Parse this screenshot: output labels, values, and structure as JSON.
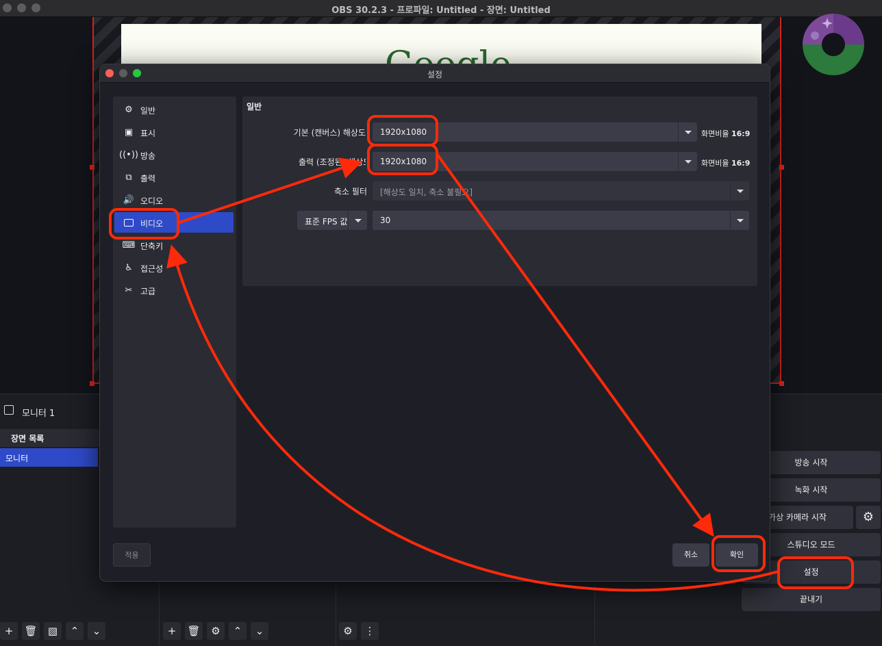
{
  "window": {
    "title": "OBS 30.2.3 - 프로파일: Untitled - 장면: Untitled"
  },
  "preview": {
    "logo_text": "Google"
  },
  "monitor_bar": {
    "label": "모니터 1"
  },
  "scenes": {
    "header": "장면 목록",
    "items": [
      "모니터"
    ]
  },
  "controls": {
    "buttons": [
      "방송 시작",
      "녹화 시작",
      "가상 카메라 시작",
      "스튜디오 모드",
      "설정",
      "끝내기"
    ]
  },
  "settings": {
    "title": "설정",
    "sidebar": [
      {
        "label": "일반",
        "icon": "gear-icon"
      },
      {
        "label": "표시",
        "icon": "display-icon"
      },
      {
        "label": "방송",
        "icon": "broadcast-icon"
      },
      {
        "label": "출력",
        "icon": "output-icon"
      },
      {
        "label": "오디오",
        "icon": "speaker-icon"
      },
      {
        "label": "비디오",
        "icon": "monitor-icon"
      },
      {
        "label": "단축키",
        "icon": "keyboard-icon"
      },
      {
        "label": "접근성",
        "icon": "accessibility-icon"
      },
      {
        "label": "고급",
        "icon": "tools-icon"
      }
    ],
    "active_section": "비디오",
    "section_title": "일반",
    "base_resolution": {
      "label": "기본 (캔버스) 해상도",
      "value": "1920x1080",
      "ratio_label": "화면비율",
      "ratio": "16:9"
    },
    "output_resolution": {
      "label": "출력 (조정된) 해상도",
      "value": "1920x1080",
      "ratio_label": "화면비율",
      "ratio": "16:9"
    },
    "downscale_filter": {
      "label": "축소 필터",
      "value": "[해상도 일치, 축소 불필요]"
    },
    "fps": {
      "type_label": "표준 FPS 값",
      "value": "30"
    },
    "buttons": {
      "apply": "적용",
      "cancel": "취소",
      "ok": "확인"
    }
  },
  "annotation": {
    "color": "#ff2a0a"
  }
}
